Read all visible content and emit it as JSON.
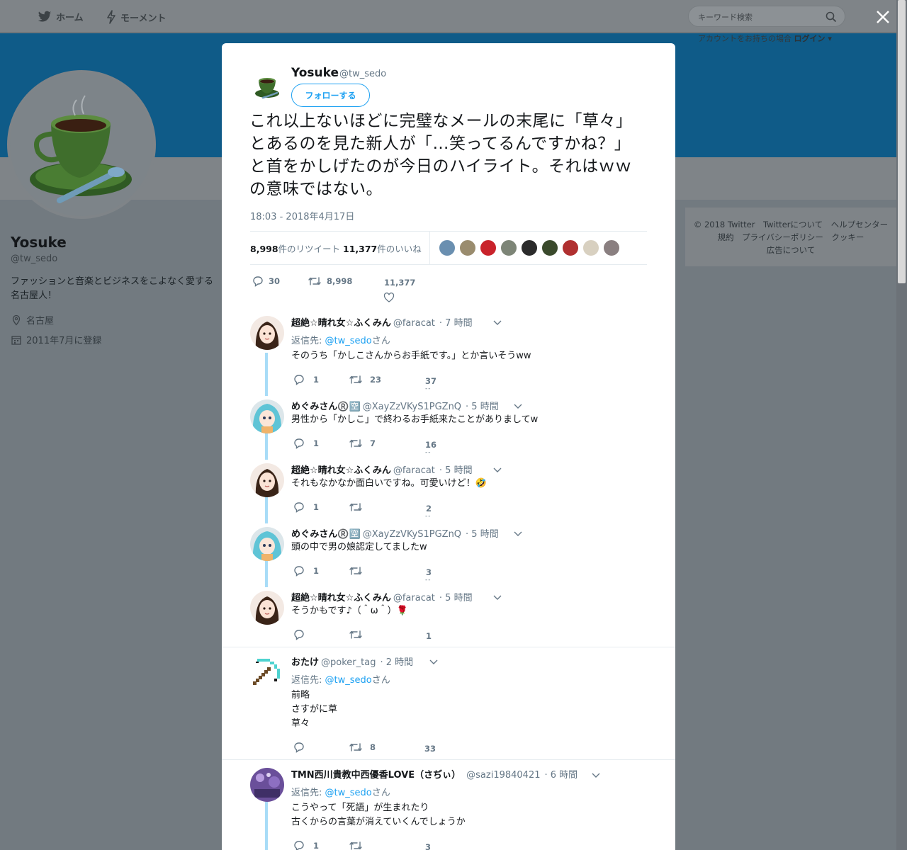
{
  "nav": {
    "home": "ホーム",
    "moments": "モーメント"
  },
  "search": {
    "placeholder": "キーワード検索"
  },
  "login_hint": {
    "prefix": "アカウントをお持ちの場合",
    "login": "ログイン ▾"
  },
  "profile": {
    "name": "Yosuke",
    "handle": "@tw_sedo",
    "bio": "ファッションと音楽とビジネスをこよなく愛する名古屋人！",
    "location": "名古屋",
    "joined": "2011年7月に登録"
  },
  "footer": {
    "line1": "© 2018 Twitter　Twitterについて　ヘルプセンター",
    "line2": "規約　プライバシーポリシー　クッキー",
    "line3": "広告について"
  },
  "tweet": {
    "name": "Yosuke",
    "handle": "@tw_sedo",
    "follow_label": "フォローする",
    "text": "これ以上ないほどに完璧なメールの末尾に「草々」とあるのを見た新人が「…笑ってるんですかね？」と首をかしげたのが今日のハイライト。それはｗｗの意味ではない。",
    "time": "18:03 - 2018年4月17日",
    "retweets_count": "8,998",
    "retweets_label": "件のリツイート",
    "likes_count": "11,377",
    "likes_label": "件のいいね",
    "actions": {
      "replies": "30",
      "retweets": "8,998",
      "likes": "11,377"
    },
    "liker_colors": [
      "#6a8fb0",
      "#9a8c6e",
      "#c9232b",
      "#7d8577",
      "#2b2b2b",
      "#3a4a2c",
      "#b03030",
      "#d8d0c0",
      "#8a7f80"
    ]
  },
  "replies": [
    {
      "name": "超絶☆晴れ女☆ふくみん",
      "handle": "@faracat",
      "time": "· 7 時間",
      "reply_to_prefix": "返信先: ",
      "reply_to_link": "@tw_sedo",
      "reply_to_suffix": "さん",
      "text": "そのうち「かしこさんからお手紙です。」とか言いそうww",
      "replies": "1",
      "retweets": "23",
      "likes": "37"
    },
    {
      "name": "めぐみさん®️🈳",
      "handle": "@XayZzVKyS1PGZnQ",
      "time": "· 5 時間",
      "text": "男性から「かしこ」で終わるお手紙来たことがありましてw",
      "replies": "1",
      "retweets": "7",
      "likes": "16"
    },
    {
      "name": "超絶☆晴れ女☆ふくみん",
      "handle": "@faracat",
      "time": "· 5 時間",
      "text": "それもなかなか面白いですね。可愛いけど！🤣",
      "replies": "1",
      "retweets": "",
      "likes": "2"
    },
    {
      "name": "めぐみさん®️🈳",
      "handle": "@XayZzVKyS1PGZnQ",
      "time": "· 5 時間",
      "text": "頭の中で男の娘認定してましたw",
      "replies": "1",
      "retweets": "",
      "likes": "3"
    },
    {
      "name": "超絶☆晴れ女☆ふくみん",
      "handle": "@faracat",
      "time": "· 5 時間",
      "text": "そうかもです♪（＾ω＾）🌹",
      "replies": "",
      "retweets": "",
      "likes": "1"
    },
    {
      "name": "おたけ",
      "handle": "@poker_tag",
      "time": "· 2 時間",
      "reply_to_prefix": "返信先: ",
      "reply_to_link": "@tw_sedo",
      "reply_to_suffix": "さん",
      "text_lines": [
        "前略",
        "さすがに草",
        "草々"
      ],
      "replies": "",
      "retweets": "8",
      "likes": "33"
    },
    {
      "name": "TMN西川貴教中西優香LOVE（さぢぃ）",
      "handle": "@sazi19840421",
      "time": "· 6 時間",
      "reply_to_prefix": "返信先: ",
      "reply_to_link": "@tw_sedo",
      "reply_to_suffix": "さん",
      "text_lines": [
        "こうやって「死語」が生まれたり",
        "古くからの言葉が消えていくんでしょうか"
      ],
      "replies": "1",
      "retweets": "",
      "likes": "3"
    }
  ],
  "colors": {
    "accent": "#1da1f2",
    "banner": "#0f5b88",
    "thread": "#a8dcf7"
  }
}
